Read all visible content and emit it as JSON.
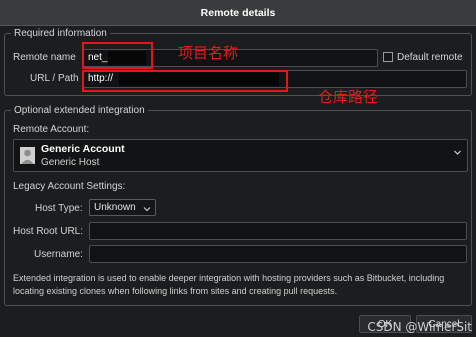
{
  "window": {
    "title": "Remote details"
  },
  "required": {
    "legend": "Required information",
    "remote_name_label": "Remote name",
    "remote_name_value": "net_",
    "default_remote_label": "Default remote",
    "default_remote_checked": false,
    "url_label": "URL / Path",
    "url_value": "http://"
  },
  "annotations": {
    "project_name": "项目名称",
    "repo_path": "仓库路径",
    "color": "#e41b1b"
  },
  "optional": {
    "legend": "Optional extended integration",
    "remote_account_label": "Remote Account:",
    "account_name": "Generic Account",
    "account_host": "Generic Host",
    "legacy_label": "Legacy Account Settings:",
    "host_type_label": "Host Type:",
    "host_type_value": "Unknown",
    "host_root_url_label": "Host Root URL:",
    "username_label": "Username:",
    "help_text": "Extended integration is used to enable deeper integration with hosting providers such as Bitbucket, including locating existing clones when following links from sites and creating pull requests."
  },
  "buttons": {
    "ok": "OK",
    "cancel": "Cancel"
  },
  "watermark": "CSDN @WimerSit"
}
